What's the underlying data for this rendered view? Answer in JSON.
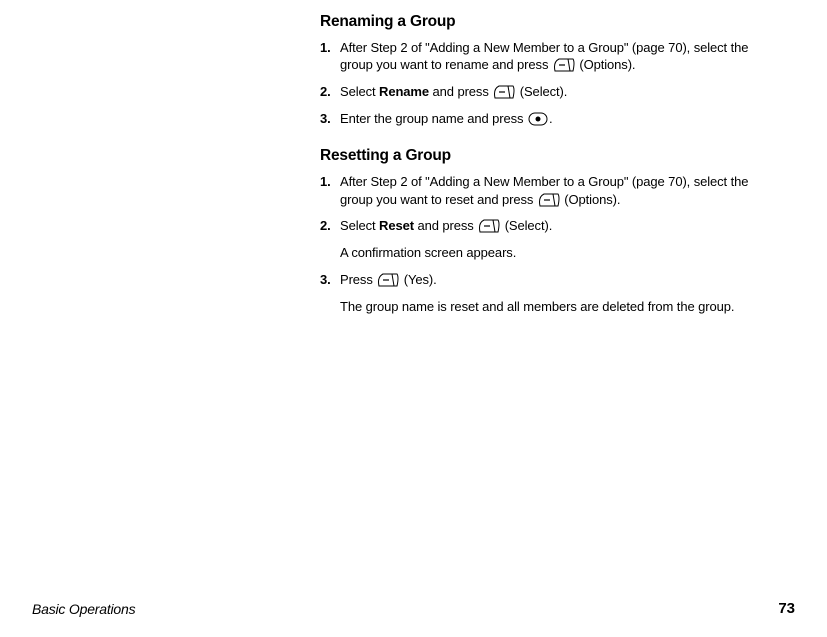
{
  "section1": {
    "title": "Renaming a Group",
    "step1_num": "1.",
    "step1_a": "After Step 2 of \"Adding a New Member to a Group\" (page 70), select the group you want to rename and press ",
    "step1_b": " (Options).",
    "step2_num": "2.",
    "step2_a": "Select ",
    "step2_bold": "Rename",
    "step2_b": " and press ",
    "step2_c": " (Select).",
    "step3_num": "3.",
    "step3_a": "Enter the group name and press ",
    "step3_b": "."
  },
  "section2": {
    "title": "Resetting a Group",
    "step1_num": "1.",
    "step1_a": "After Step 2 of \"Adding a New Member to a Group\" (page 70), select the group you want to reset and press ",
    "step1_b": " (Options).",
    "step2_num": "2.",
    "step2_a": "Select ",
    "step2_bold": "Reset",
    "step2_b": " and press ",
    "step2_c": " (Select).",
    "step2_note": "A confirmation screen appears.",
    "step3_num": "3.",
    "step3_a": "Press ",
    "step3_b": " (Yes).",
    "step3_note": "The group name is reset and all members are deleted from the group."
  },
  "footer": {
    "left": "Basic Operations",
    "right": "73"
  }
}
